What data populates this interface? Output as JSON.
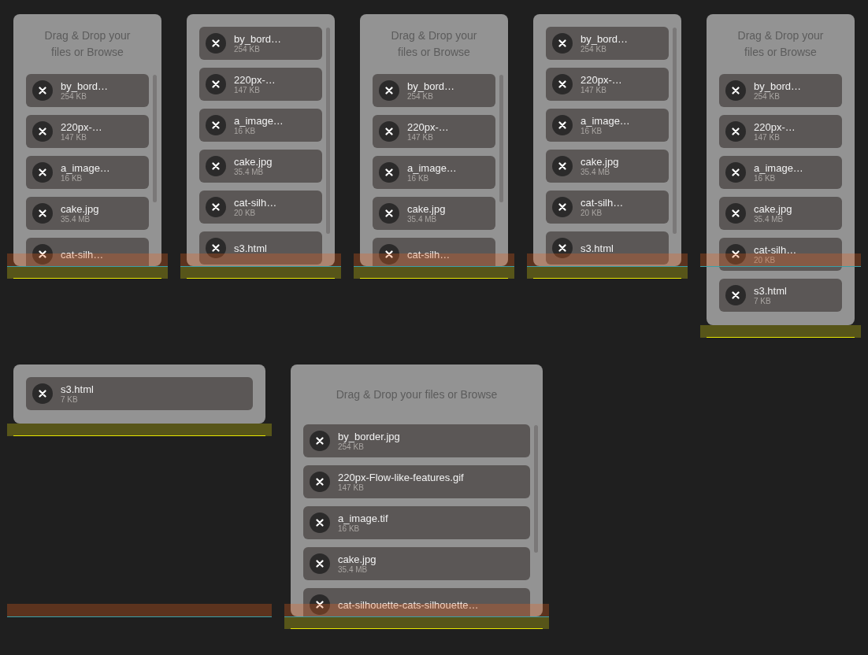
{
  "rows": [
    {
      "panels": [
        {
          "header": "Drag & Drop your files or Browse",
          "scrollbar": true,
          "files": [
            {
              "name": "by_bord…",
              "size": "254 KB"
            },
            {
              "name": "220px-…",
              "size": "147 KB"
            },
            {
              "name": "a_image…",
              "size": "16 KB"
            },
            {
              "name": "cake.jpg",
              "size": "35.4 MB"
            },
            {
              "name": "cat-silh…"
            }
          ]
        },
        {
          "scrollbar": true,
          "files": [
            {
              "name": "by_bord…",
              "size": "254 KB"
            },
            {
              "name": "220px-…",
              "size": "147 KB"
            },
            {
              "name": "a_image…",
              "size": "16 KB"
            },
            {
              "name": "cake.jpg",
              "size": "35.4 MB"
            },
            {
              "name": "cat-silh…",
              "size": "20 KB"
            },
            {
              "name": "s3.html"
            }
          ]
        },
        {
          "header": "Drag & Drop your files or Browse",
          "scrollbar": true,
          "files": [
            {
              "name": "by_bord…",
              "size": "254 KB"
            },
            {
              "name": "220px-…",
              "size": "147 KB"
            },
            {
              "name": "a_image…",
              "size": "16 KB"
            },
            {
              "name": "cake.jpg",
              "size": "35.4 MB"
            },
            {
              "name": "cat-silh…"
            }
          ]
        },
        {
          "scrollbar": true,
          "files": [
            {
              "name": "by_bord…",
              "size": "254 KB"
            },
            {
              "name": "220px-…",
              "size": "147 KB"
            },
            {
              "name": "a_image…",
              "size": "16 KB"
            },
            {
              "name": "cake.jpg",
              "size": "35.4 MB"
            },
            {
              "name": "cat-silh…",
              "size": "20 KB"
            },
            {
              "name": "s3.html"
            }
          ]
        },
        {
          "header": "Drag & Drop your files or Browse",
          "scrollbar": false,
          "files": [
            {
              "name": "by_bord…",
              "size": "254 KB"
            },
            {
              "name": "220px-…",
              "size": "147 KB"
            },
            {
              "name": "a_image…",
              "size": "16 KB"
            },
            {
              "name": "cake.jpg",
              "size": "35.4 MB"
            },
            {
              "name": "cat-silh…",
              "size": "20 KB"
            },
            {
              "name": "s3.html",
              "size": "7 KB"
            }
          ]
        }
      ]
    },
    {
      "panels": [
        {
          "scrollbar": false,
          "files": [
            {
              "name": "s3.html",
              "size": "7 KB"
            }
          ]
        },
        {
          "header": "Drag & Drop your files or Browse",
          "scrollbar": true,
          "files": [
            {
              "name": "by_border.jpg",
              "size": "254 KB"
            },
            {
              "name": "220px-Flow-like-features.gif",
              "size": "147 KB"
            },
            {
              "name": "a_image.tif",
              "size": "16 KB"
            },
            {
              "name": "cake.jpg",
              "size": "35.4 MB"
            },
            {
              "name": "cat-silhouette-cats-silhouette…"
            }
          ]
        }
      ]
    }
  ]
}
